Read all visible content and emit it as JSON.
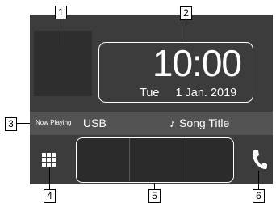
{
  "clock": {
    "time": "10:00",
    "day": "Tue",
    "date": "1 Jan. 2019"
  },
  "now_playing": {
    "label": "Now Playing",
    "source": "USB",
    "note_symbol": "♪",
    "song_title": "Song Title"
  },
  "callouts": [
    "1",
    "2",
    "3",
    "4",
    "5",
    "6"
  ],
  "icons": {
    "menu": "grid-icon",
    "phone": "phone-icon"
  },
  "colors": {
    "screen_bg": "#3c3c3c",
    "now_playing_bar": "#535353",
    "border_highlight": "#ffffff"
  }
}
